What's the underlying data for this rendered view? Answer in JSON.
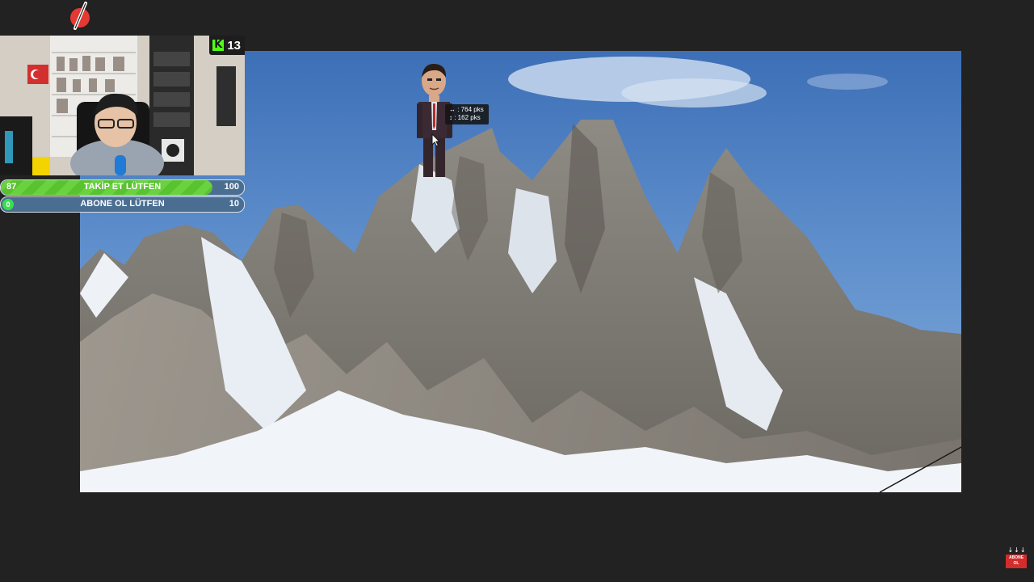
{
  "overlay": {
    "logo_icon": "pencil-slash-logo",
    "kick": {
      "icon": "kick-logo",
      "letter": "K",
      "viewer_count": "13",
      "accent": "#53fc18"
    },
    "goals": [
      {
        "current": "87",
        "label": "TAKİP ET LÜTFEN",
        "target": "100",
        "fraction": 0.87
      },
      {
        "current": "0",
        "label": "ABONE OL LÜTFEN",
        "target": "10",
        "fraction": 0
      }
    ]
  },
  "scene": {
    "tooltip": {
      "height_label": "↔ : 764 pks",
      "width_label": "↕ : 162 pks"
    }
  },
  "subscribe_corner": {
    "arrows": "↓↓↓",
    "label": "ABONE OL",
    "color": "#d22c2c"
  }
}
